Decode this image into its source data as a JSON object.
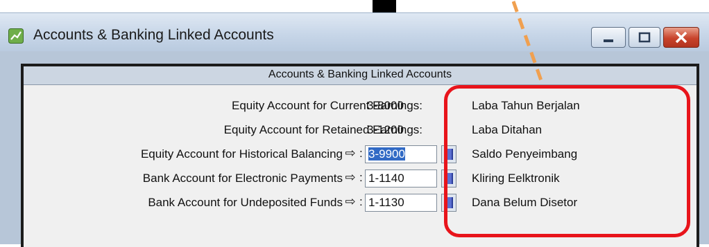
{
  "window": {
    "title": "Accounts & Banking Linked Accounts",
    "panel_title": "Accounts & Banking Linked Accounts"
  },
  "rows": [
    {
      "label": "Equity Account for Current Earnings:",
      "code": "3-8000",
      "desc": "Laba Tahun Berjalan",
      "editable": false
    },
    {
      "label": "Equity Account for Retained Earnings:",
      "code": "3-1200",
      "desc": "Laba Ditahan",
      "editable": false
    },
    {
      "label": "Equity Account for Historical Balancing",
      "code": "3-9900",
      "desc": "Saldo Penyeimbang",
      "editable": true
    },
    {
      "label": "Bank Account for Electronic Payments",
      "code": "1-1140",
      "desc": "Kliring Eelktronik",
      "editable": true
    },
    {
      "label": "Bank Account for Undeposited Funds",
      "code": "1-1130",
      "desc": "Dana Belum Disetor",
      "editable": true
    }
  ],
  "glyphs": {
    "arrow": "⇨",
    "colon": ":"
  },
  "colors": {
    "annotation_red": "#e8141b",
    "annotation_orange": "#f0a050",
    "selection": "#316ac5"
  }
}
